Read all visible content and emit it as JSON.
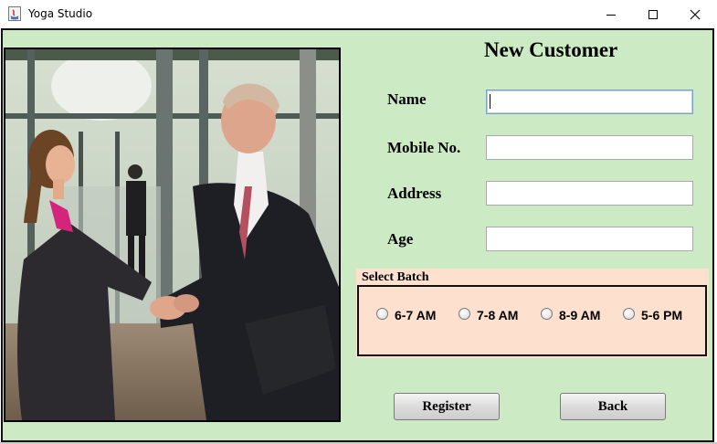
{
  "window": {
    "title": "Yoga Studio",
    "icon": "java-app-icon",
    "controls": [
      "minimize-icon",
      "maximize-icon",
      "close-icon"
    ]
  },
  "form": {
    "heading": "New Customer",
    "fields": [
      {
        "label": "Name",
        "value": "",
        "focused": true
      },
      {
        "label": "Mobile No.",
        "value": ""
      },
      {
        "label": "Address",
        "value": ""
      },
      {
        "label": "Age",
        "value": ""
      }
    ]
  },
  "batch": {
    "title": "Select Batch",
    "options": [
      "6-7 AM",
      "7-8 AM",
      "8-9 AM",
      "5-6 PM"
    ],
    "selected": null
  },
  "buttons": {
    "register": "Register",
    "back": "Back"
  },
  "image": {
    "subject": "business-handshake-photo"
  },
  "colors": {
    "background": "#cceac4",
    "batch_panel": "#fde0cd"
  }
}
